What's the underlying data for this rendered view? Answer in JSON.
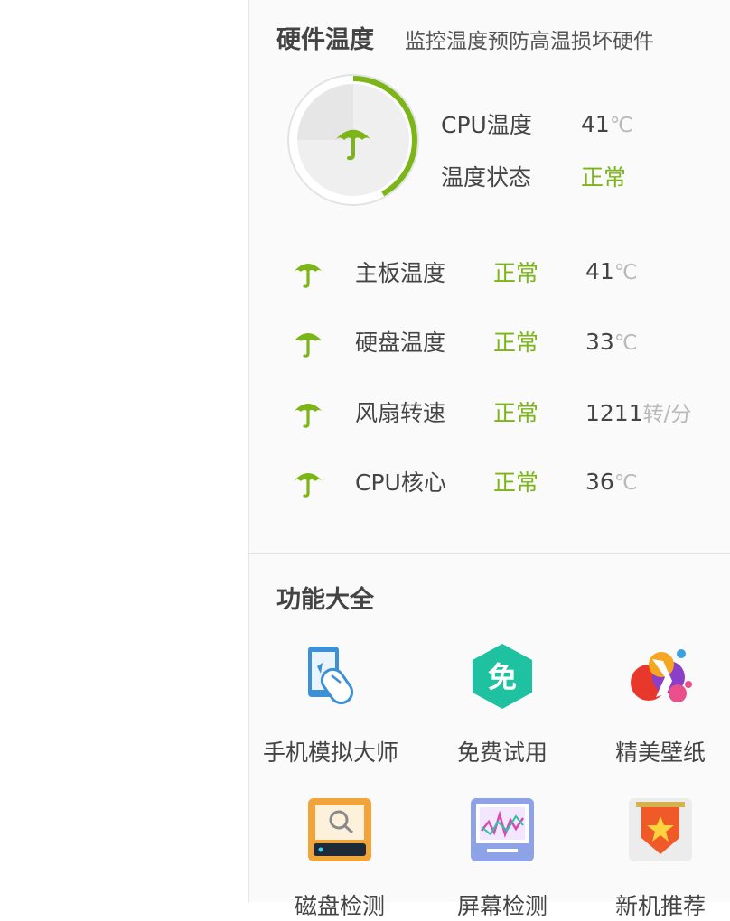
{
  "hardware": {
    "title": "硬件温度",
    "subtitle": "监控温度预防高温损坏硬件",
    "gauge_level": 0.42,
    "accent_color": "#7cb518",
    "cpu": {
      "temp_label": "CPU温度",
      "temp_value": "41",
      "temp_unit": "℃",
      "status_label": "温度状态",
      "status_value": "正常"
    },
    "sensors": [
      {
        "name": "主板温度",
        "status": "正常",
        "value": "41",
        "unit": "℃",
        "icon": "umbrella-icon"
      },
      {
        "name": "硬盘温度",
        "status": "正常",
        "value": "33",
        "unit": "℃",
        "icon": "umbrella-icon"
      },
      {
        "name": "风扇转速",
        "status": "正常",
        "value": "1211",
        "unit": "转/分",
        "icon": "umbrella-icon"
      },
      {
        "name": "CPU核心",
        "status": "正常",
        "value": "36",
        "unit": "℃",
        "icon": "umbrella-icon"
      }
    ]
  },
  "features": {
    "title": "功能大全",
    "items": [
      {
        "label": "手机模拟大师",
        "icon": "phone-mouse-icon"
      },
      {
        "label": "免费试用",
        "icon": "free-hexagon-icon"
      },
      {
        "label": "精美壁纸",
        "icon": "wallpaper-icon"
      },
      {
        "label": "磁盘检测",
        "icon": "disk-check-icon"
      },
      {
        "label": "屏幕检测",
        "icon": "screen-check-icon"
      },
      {
        "label": "新机推荐",
        "icon": "star-badge-icon"
      }
    ],
    "free_glyph": "免"
  }
}
